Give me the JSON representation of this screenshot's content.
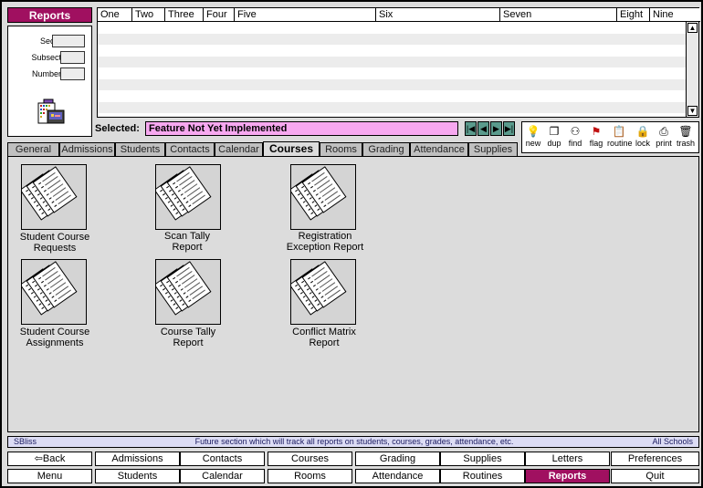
{
  "app": {
    "title": "Reports"
  },
  "filters": {
    "sect_label": "Sect",
    "subsect_label": "Subsect",
    "number_label": "Number"
  },
  "columns": [
    "One",
    "Two",
    "Three",
    "Four",
    "Five",
    "Six",
    "Seven",
    "Eight",
    "Nine"
  ],
  "selected": {
    "label": "Selected:",
    "value": "Feature Not Yet Implemented"
  },
  "toolbar": [
    {
      "label": "new",
      "icon": "lightbulb-icon"
    },
    {
      "label": "dup",
      "icon": "duplicate-icon"
    },
    {
      "label": "find",
      "icon": "glasses-icon"
    },
    {
      "label": "flag",
      "icon": "flag-icon"
    },
    {
      "label": "routine",
      "icon": "clipboard-icon"
    },
    {
      "label": "lock",
      "icon": "lock-icon"
    },
    {
      "label": "print",
      "icon": "printer-icon"
    },
    {
      "label": "trash",
      "icon": "trash-icon"
    }
  ],
  "tabs": [
    "General",
    "Admissions",
    "Students",
    "Contacts",
    "Calendar",
    "Courses",
    "Rooms",
    "Grading",
    "Attendance",
    "Supplies"
  ],
  "active_tab": "Courses",
  "reports": [
    {
      "line1": "Student Course",
      "line2": "Requests"
    },
    {
      "line1": "Scan Tally",
      "line2": "Report"
    },
    {
      "line1": "Registration",
      "line2": "Exception Report"
    },
    {
      "line1": "Student Course",
      "line2": "Assignments"
    },
    {
      "line1": "Course Tally",
      "line2": "Report"
    },
    {
      "line1": "Conflict Matrix",
      "line2": "Report"
    }
  ],
  "status": {
    "left": "SBliss",
    "center": "Future section which will track all reports on students, courses, grades, attendance, etc.",
    "right": "All Schools"
  },
  "bottom_nav": {
    "row1": [
      "Back",
      "Admissions",
      "Contacts",
      "Courses",
      "Grading",
      "Supplies",
      "Letters",
      "Preferences"
    ],
    "row2": [
      "Menu",
      "Students",
      "Calendar",
      "Rooms",
      "Attendance",
      "Routines",
      "Reports",
      "Quit"
    ]
  },
  "colors": {
    "accent": "#a01060",
    "selected_bg": "#f7a8f0",
    "status_bg": "#dcdcf4"
  }
}
